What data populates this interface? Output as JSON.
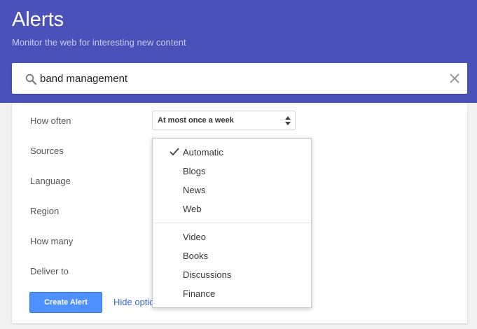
{
  "header": {
    "title": "Alerts",
    "subtitle": "Monitor the web for interesting new content"
  },
  "search": {
    "value": "band management",
    "icon": "search-icon",
    "clear_icon": "close-icon"
  },
  "options": {
    "how_often_label": "How often",
    "how_often_value": "At most once a week",
    "sources_label": "Sources",
    "language_label": "Language",
    "region_label": "Region",
    "how_many_label": "How many",
    "deliver_to_label": "Deliver to"
  },
  "actions": {
    "create_label": "Create Alert",
    "hide_options_label": "Hide optio"
  },
  "sources_menu": {
    "selected": "Automatic",
    "group1": [
      "Automatic",
      "Blogs",
      "News",
      "Web"
    ],
    "group2": [
      "Video",
      "Books",
      "Discussions",
      "Finance"
    ]
  },
  "colors": {
    "header_bg": "#4a51b8",
    "button_bg": "#4d90fe",
    "link": "#3367d6"
  }
}
